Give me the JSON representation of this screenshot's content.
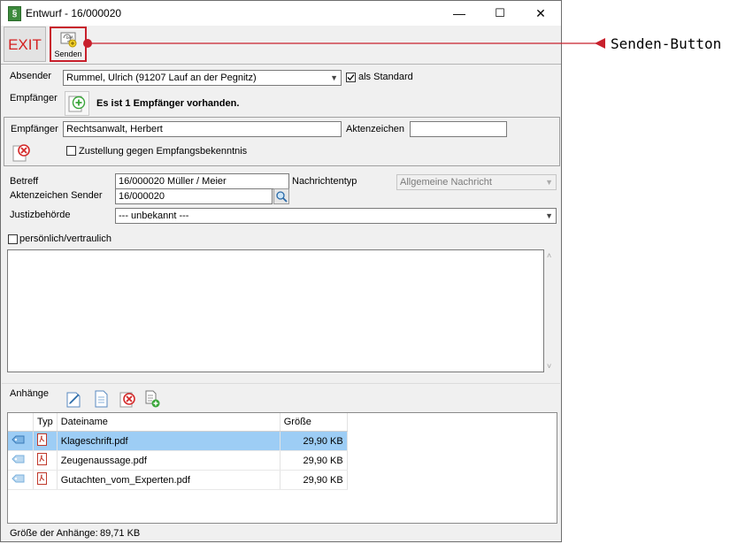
{
  "window": {
    "title": "Entwurf - 16/000020",
    "minimize_glyph": "—",
    "maximize_glyph": "☐",
    "close_glyph": "✕"
  },
  "toolbar": {
    "exit_label": "EXIT",
    "send_label": "Senden"
  },
  "sender": {
    "label": "Absender",
    "value": "Rummel, Ulrich (91207 Lauf an der Pegnitz)",
    "default_label": "als Standard",
    "default_checked": true
  },
  "recipients": {
    "label": "Empfänger",
    "count_text": "Es ist 1 Empfänger vorhanden.",
    "recipient_label": "Empfänger",
    "recipient_value": "Rechtsanwalt, Herbert",
    "reference_label": "Aktenzeichen",
    "reference_value": "",
    "delivery_label": "Zustellung gegen Empfangsbekenntnis",
    "delivery_checked": false
  },
  "message": {
    "subject_label": "Betreff",
    "subject_value": "16/000020  Müller / Meier",
    "type_label": "Nachrichtentyp",
    "type_value": "Allgemeine Nachricht",
    "sender_ref_label": "Aktenzeichen Sender",
    "sender_ref_value": "16/000020",
    "authority_label": "Justizbehörde",
    "authority_value": "--- unbekannt ---",
    "confidential_label": "persönlich/vertraulich",
    "confidential_checked": false,
    "body": ""
  },
  "attachments": {
    "label": "Anhänge",
    "columns": {
      "type": "Typ",
      "name": "Dateiname",
      "size": "Größe"
    },
    "rows": [
      {
        "name": "Klageschrift.pdf",
        "size": "29,90 KB",
        "selected": true
      },
      {
        "name": "Zeugenaussage.pdf",
        "size": "29,90 KB",
        "selected": false
      },
      {
        "name": "Gutachten_vom_Experten.pdf",
        "size": "29,90 KB",
        "selected": false
      }
    ],
    "total_label": "Größe der Anhänge:",
    "total_value": "89,71 KB"
  },
  "annotation": {
    "text": "Senden-Button",
    "color": "#c8202c"
  }
}
